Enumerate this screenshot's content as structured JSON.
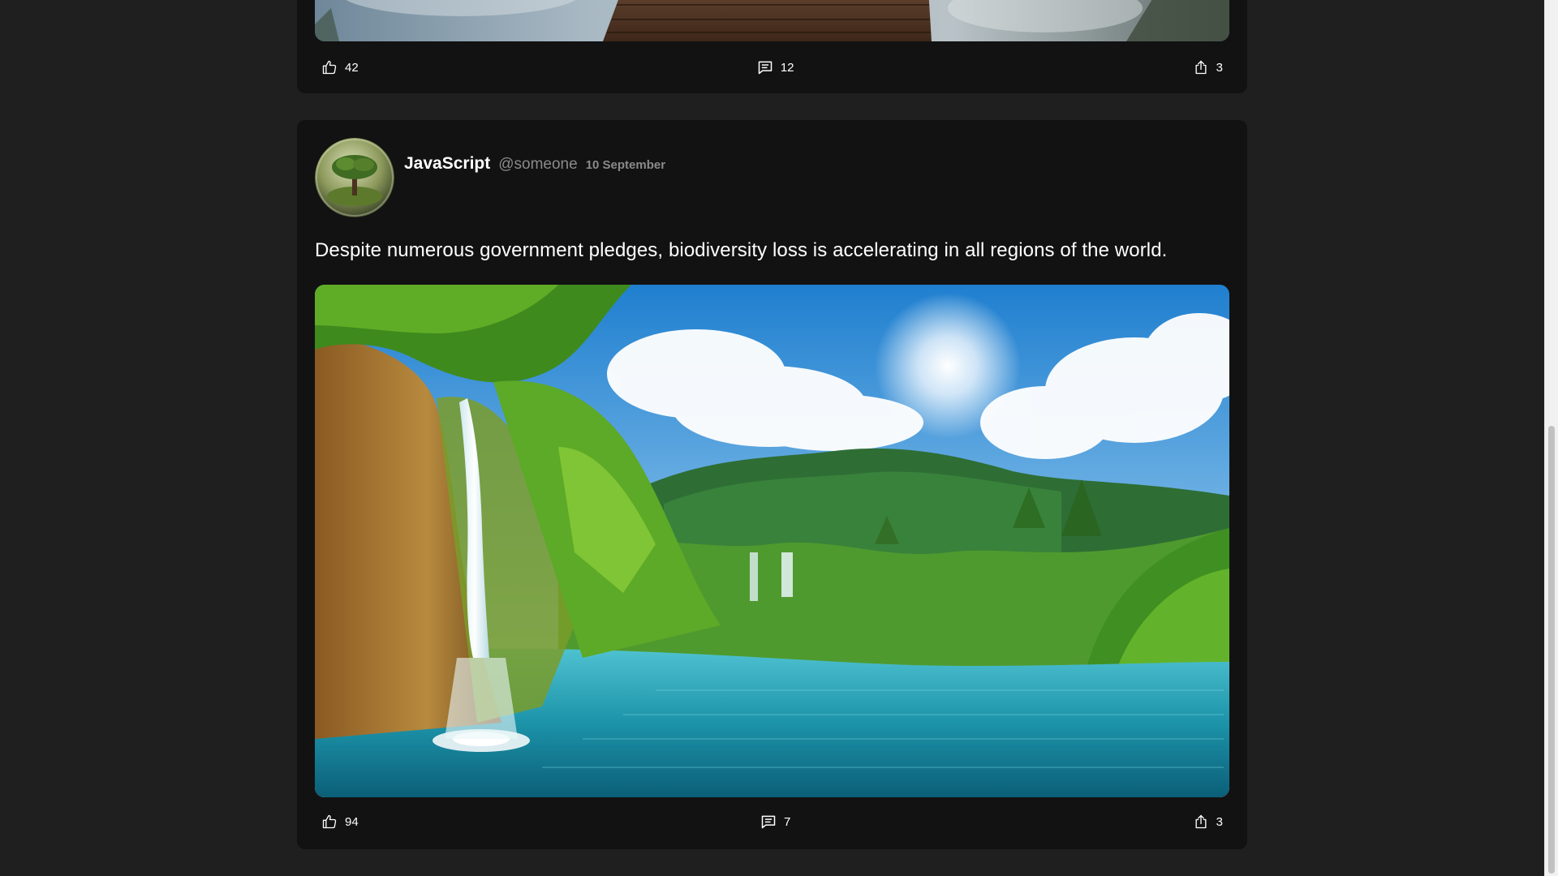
{
  "previous_post": {
    "likes": "42",
    "comments": "12",
    "shares": "3"
  },
  "post": {
    "author": "JavaScript",
    "handle": "@someone",
    "date": "10 September",
    "text": "Despite numerous government pledges, biodiversity loss is accelerating in all regions of the world.",
    "likes": "94",
    "comments": "7",
    "shares": "3"
  },
  "icons": {
    "like": "thumbs-up-icon",
    "comment": "comment-icon",
    "share": "share-icon"
  },
  "colors": {
    "page_background": "#1f1f1f",
    "card_background": "#121212",
    "muted_text": "#8a8a8a"
  }
}
